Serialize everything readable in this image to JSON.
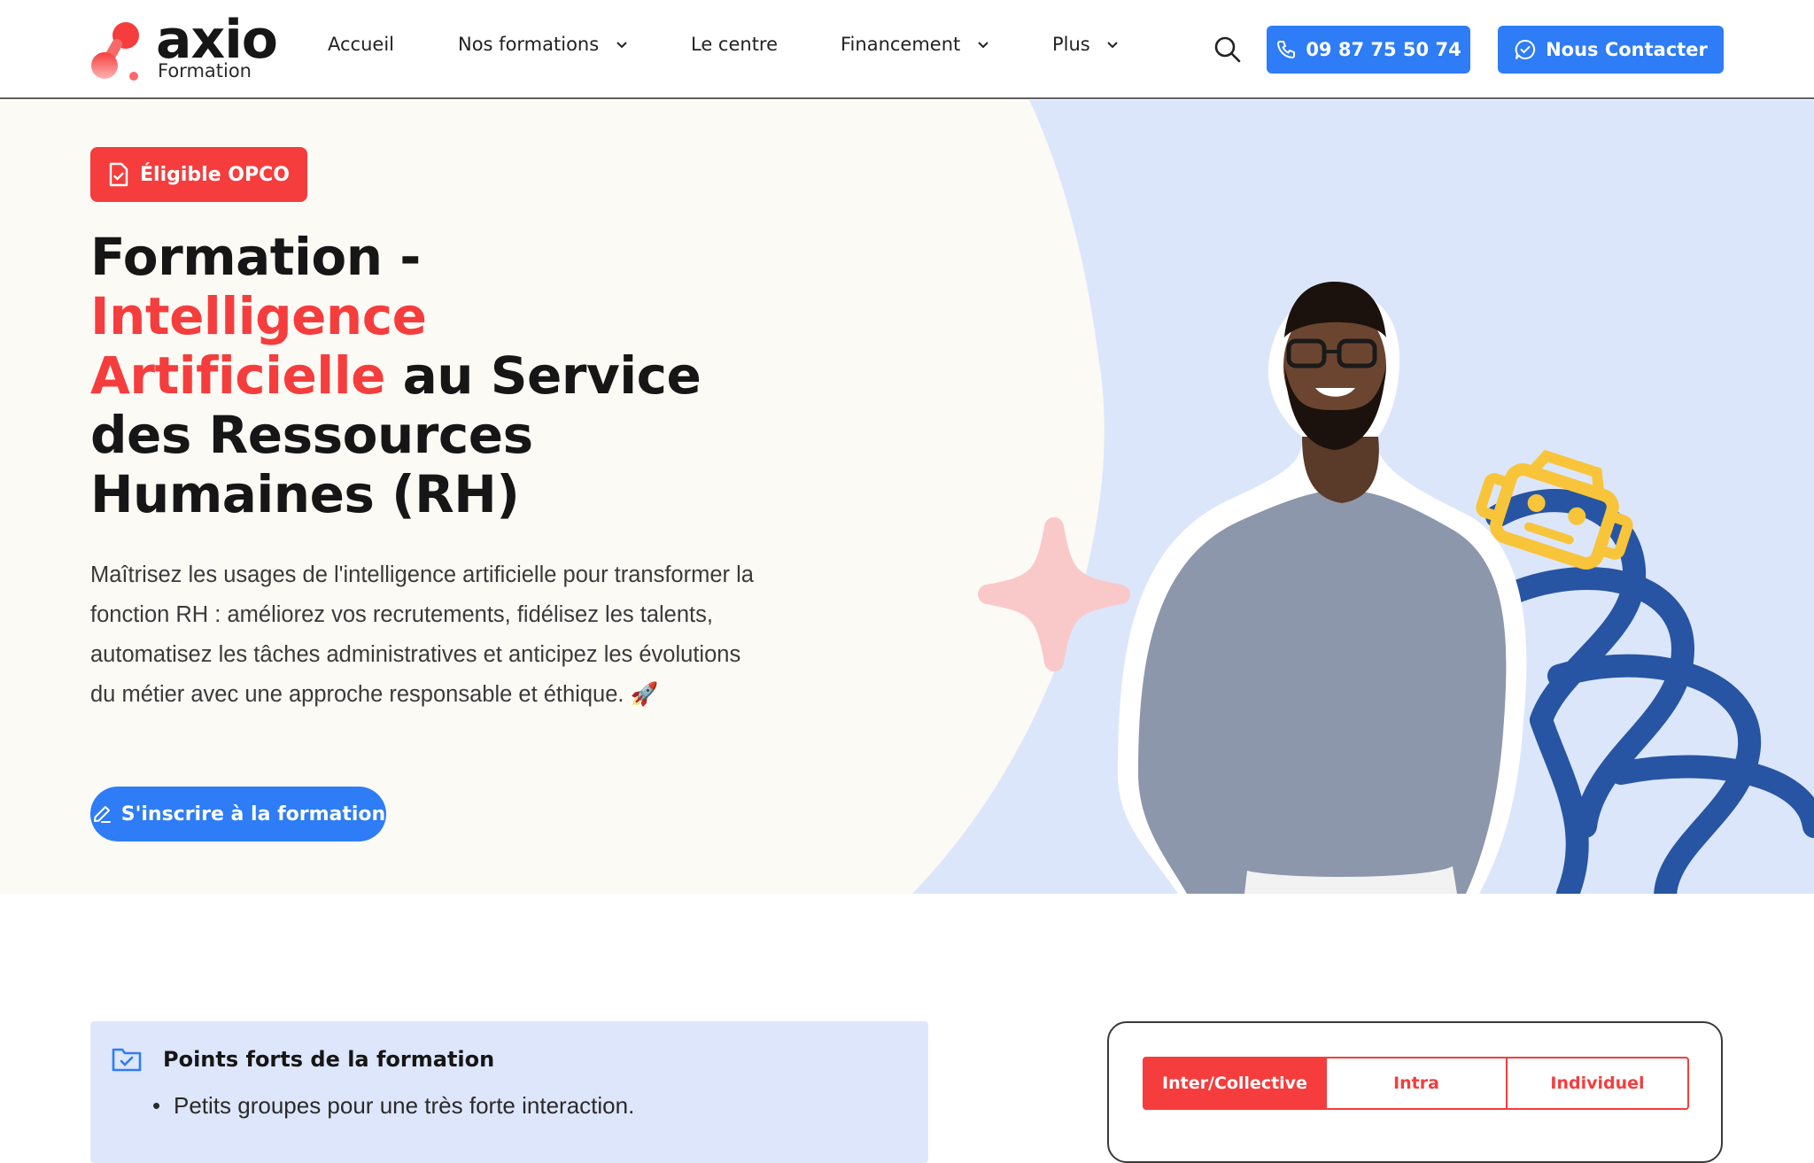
{
  "brand": {
    "name": "axio",
    "subtitle": "Formation",
    "accent": "#f53d3d",
    "blue": "#2e7cf6"
  },
  "nav": {
    "items": [
      {
        "label": "Accueil",
        "dropdown": false
      },
      {
        "label": "Nos formations",
        "dropdown": true
      },
      {
        "label": "Le centre",
        "dropdown": false
      },
      {
        "label": "Financement",
        "dropdown": true
      },
      {
        "label": "Plus",
        "dropdown": true
      }
    ],
    "phone_label": "09 87 75 50 74",
    "contact_label": "Nous Contacter"
  },
  "hero": {
    "badge": "Éligible OPCO",
    "title_part1": "Formation -",
    "title_highlight_1": "Intelligence",
    "title_highlight_2": "Artificielle",
    "title_part2": " au Service des Ressources Humaines (RH)",
    "description": "Maîtrisez les usages de l'intelligence artificielle pour transformer la fonction RH : améliorez vos recrutements, fidélisez les talents, automatisez les tâches administratives et anticipez les évolutions du métier avec une approche responsable et éthique. 🚀",
    "cta_label": "S'inscrire à la formation"
  },
  "features": {
    "title": "Points forts de la formation",
    "items": [
      "Petits groupes pour une très forte interaction."
    ]
  },
  "pricing": {
    "tabs": [
      "Inter/Collective",
      "Intra",
      "Individuel"
    ],
    "active_tab": "Inter/Collective"
  }
}
